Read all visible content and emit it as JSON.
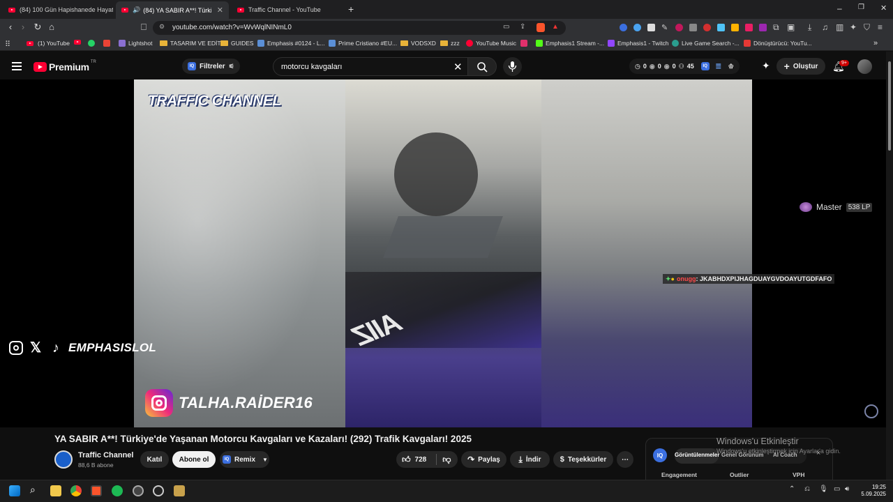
{
  "browser": {
    "tabs": [
      {
        "title": "(84) 100 Gün Hapishanede Hayatta K"
      },
      {
        "title": "(84) YA SABIR A**! Türkiye'de"
      },
      {
        "title": "Traffic Channel - YouTube"
      }
    ],
    "new_tab": "+",
    "url": "youtube.com/watch?v=WvWqlNINmL0",
    "bookmarks": [
      {
        "label": "(1) YouTube"
      },
      {
        "label": "Lightshot"
      },
      {
        "label": "TASARIM VE EDİT"
      },
      {
        "label": "GUIDES"
      },
      {
        "label": "Emphasis #0124 - L..."
      },
      {
        "label": "Prime Cristiano #EU..."
      },
      {
        "label": "VODSXD"
      },
      {
        "label": "zzz"
      },
      {
        "label": "YouTube Music"
      },
      {
        "label": "Emphasis1 Stream -..."
      },
      {
        "label": "Emphasis1 - Twitch"
      },
      {
        "label": "Live Game Search -..."
      },
      {
        "label": "Dönüştürücü: YouTu..."
      }
    ],
    "bookmarks_more": "»"
  },
  "youtube": {
    "logo_text": "Premium",
    "logo_region": "TR",
    "filters_label": "Filtreler",
    "filters_icon_text": "IQ",
    "search_value": "motorcu kavgaları",
    "stats": {
      "views": "0",
      "likes": "0",
      "eyes": "0",
      "users": "45"
    },
    "create_label": "Oluştur",
    "notification_count": "9+"
  },
  "video": {
    "overlay_channel": "TRAFFIC CHANNEL",
    "overlay_social_name": "EMPHASISLOL",
    "overlay_ig_handle": "TALHA.RAİDER16",
    "rider_text": "AIIZ",
    "rank_label": "Master",
    "rank_lp": "538 LP",
    "chat_user": "onugg",
    "chat_message": ": JKABHDXPIJHAGDUAYGVDOAYUTGDFAFO"
  },
  "details": {
    "title": "YA SABIR A**! Türkiye'de Yaşanan Motorcu Kavgaları ve Kazaları! (292) Trafik Kavgaları! 2025",
    "channel_name": "Traffic Channel",
    "subscribers": "88,6 B abone",
    "join_label": "Katıl",
    "subscribe_label": "Abone ol",
    "remix_label": "Remix",
    "likes": "728",
    "share_label": "Paylaş",
    "download_label": "İndir",
    "thanks_label": "Teşekkürler",
    "more_label": "⋯"
  },
  "panel": {
    "logo_text": "IQ",
    "tabs": [
      "Görüntülenmeler",
      "Genel Görünüm",
      "AI Coach"
    ],
    "columns": [
      "Engagement",
      "Outlier",
      "VPH"
    ],
    "close": "×"
  },
  "windows": {
    "activate_title": "Windows'u Etkinleştir",
    "activate_sub": "Windows'u etkinleştirmek için Ayarlar'a gidin.",
    "time": "19:25",
    "date": "5.09.2025"
  },
  "colors": {
    "youtube_red": "#ff0033",
    "accent_blue": "#3b6fe0",
    "background": "#0f0f0f"
  }
}
